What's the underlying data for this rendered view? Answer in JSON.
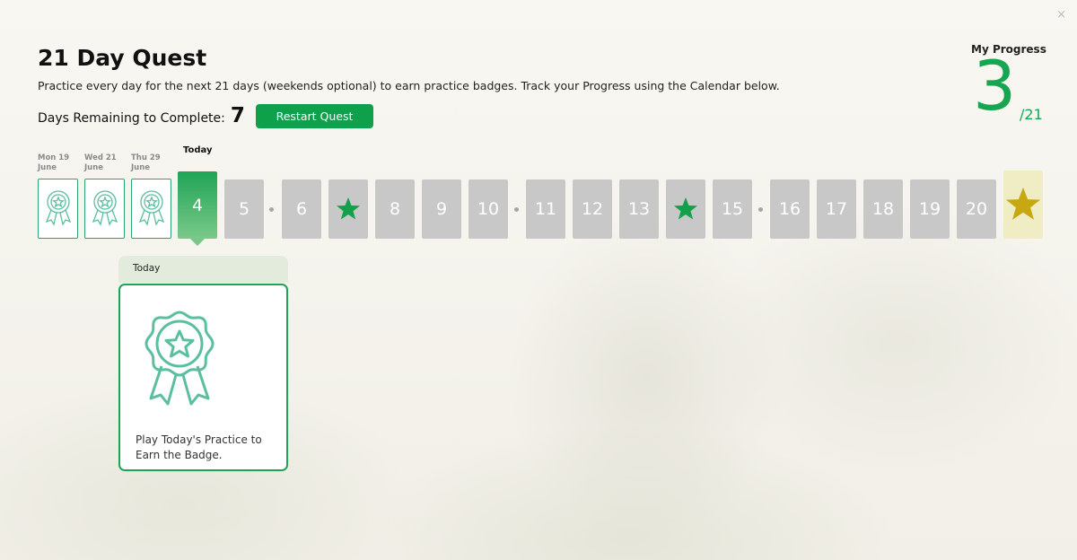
{
  "quest": {
    "title": "21 Day Quest",
    "description": "Practice every day for the next 21 days (weekends optional) to earn practice badges. Track your Progress using the Calendar below.",
    "remaining_label": "Days Remaining to Complete:",
    "remaining_value": "7",
    "restart_label": "Restart Quest",
    "close_label": "×"
  },
  "progress": {
    "label": "My Progress",
    "value": "3",
    "total": "/21"
  },
  "calendar": {
    "today_label": "Today",
    "past_days": [
      {
        "date_line1": "Mon 19",
        "date_line2": "June",
        "icon": "badge-icon"
      },
      {
        "date_line1": "Wed 21",
        "date_line2": "June",
        "icon": "badge-icon"
      },
      {
        "date_line1": "Thu 29",
        "date_line2": "June",
        "icon": "badge-icon"
      }
    ],
    "days": [
      {
        "label": "4",
        "state": "today"
      },
      {
        "label": "5",
        "state": "upcoming"
      },
      {
        "label": "6",
        "state": "upcoming"
      },
      {
        "label": "",
        "state": "star",
        "icon": "star-icon"
      },
      {
        "label": "8",
        "state": "upcoming"
      },
      {
        "label": "9",
        "state": "upcoming"
      },
      {
        "label": "10",
        "state": "upcoming"
      },
      {
        "label": "11",
        "state": "upcoming"
      },
      {
        "label": "12",
        "state": "upcoming"
      },
      {
        "label": "13",
        "state": "upcoming"
      },
      {
        "label": "",
        "state": "star",
        "icon": "star-icon"
      },
      {
        "label": "15",
        "state": "upcoming"
      },
      {
        "label": "16",
        "state": "upcoming"
      },
      {
        "label": "17",
        "state": "upcoming"
      },
      {
        "label": "18",
        "state": "upcoming"
      },
      {
        "label": "19",
        "state": "upcoming"
      },
      {
        "label": "20",
        "state": "upcoming"
      },
      {
        "label": "",
        "state": "final",
        "icon": "gold-star-icon"
      }
    ]
  },
  "popup": {
    "header": "Today",
    "message": "Play Today's Practice to Earn the Badge."
  },
  "colors": {
    "accent": "#0fa04b",
    "star": "#12a04a",
    "gold_star": "#c7a813",
    "day_gray": "#c8c8c8",
    "badge_line": "#5bbf9f"
  }
}
